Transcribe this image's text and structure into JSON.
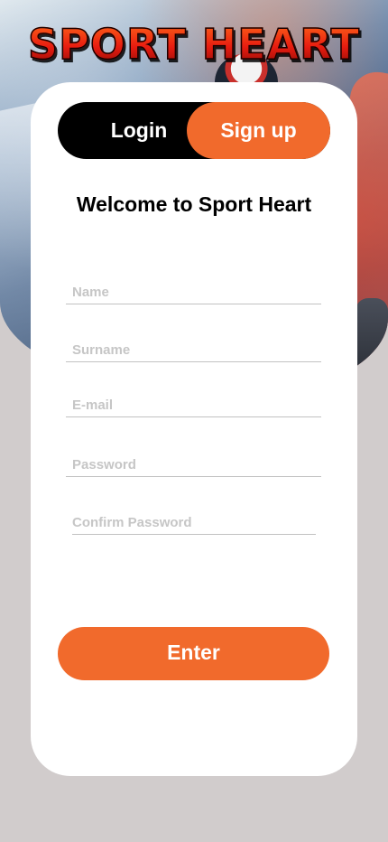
{
  "app": {
    "logo_text": "SPORT HEART"
  },
  "auth_toggle": {
    "login_label": "Login",
    "signup_label": "Sign up",
    "active": "Sign up"
  },
  "form": {
    "welcome_title": "Welcome to Sport Heart",
    "fields": [
      {
        "name": "name",
        "placeholder": "Name",
        "value": ""
      },
      {
        "name": "surname",
        "placeholder": "Surname",
        "value": ""
      },
      {
        "name": "email",
        "placeholder": "E-mail",
        "value": ""
      },
      {
        "name": "password",
        "placeholder": "Password",
        "value": ""
      },
      {
        "name": "confirm_password",
        "placeholder": "Confirm Password",
        "value": ""
      }
    ],
    "submit_label": "Enter"
  },
  "colors": {
    "accent": "#f16a2c",
    "toggle_background": "#000000",
    "card_background": "#ffffff",
    "page_background": "#d1cccc"
  }
}
